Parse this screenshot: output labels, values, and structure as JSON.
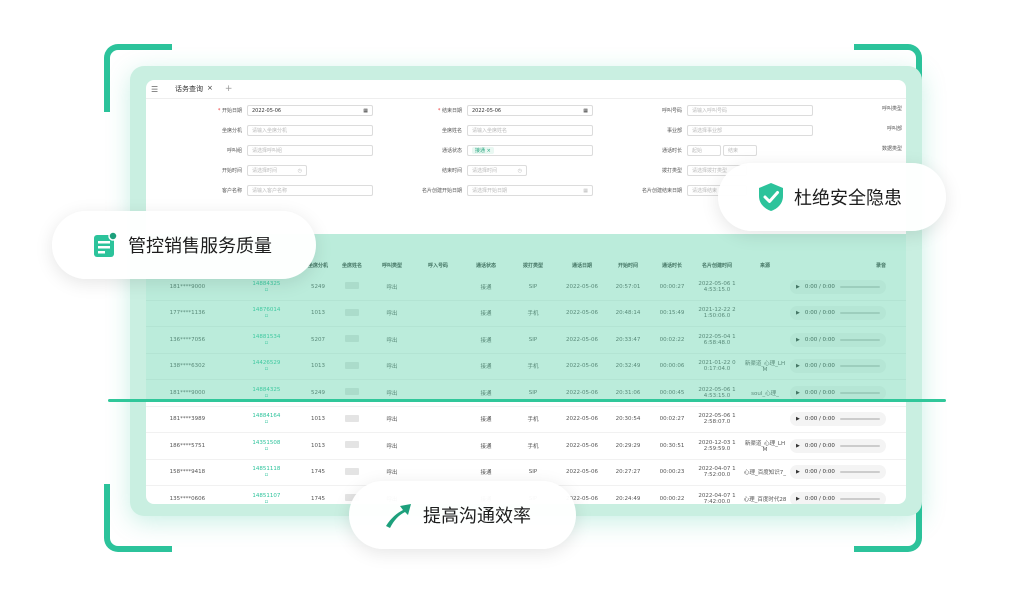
{
  "tab": {
    "label": "话务查询",
    "close": "×",
    "add": "+"
  },
  "form": {
    "start_date_label": "开始日期",
    "start_date_value": "2022-05-06",
    "end_date_label": "结束日期",
    "end_date_value": "2022-05-06",
    "caller_label": "呼叫号码",
    "caller_placeholder": "请输入呼叫号码",
    "call_type_label": "呼叫类型",
    "seat_ext_label": "坐席分机",
    "seat_ext_placeholder": "请输入坐席分机",
    "seat_name_label": "坐席姓名",
    "seat_name_placeholder": "请输入坐席姓名",
    "dept_label": "事业部",
    "dept_placeholder": "请选择事业部",
    "group_label": "呼叫部",
    "call_group_label": "呼叫组",
    "call_group_placeholder": "请选择呼叫组",
    "status_label": "通话状态",
    "status_chip": "接通",
    "duration_label": "通话时长",
    "duration_from": "起始",
    "duration_to": "结束",
    "data_type_label": "数据类型",
    "start_time_label": "开始时间",
    "start_time_placeholder": "请选择时间",
    "end_time_label": "结束时间",
    "end_time_placeholder": "请选择时间",
    "dial_type_label": "拨打类型",
    "dial_type_placeholder": "请选择拨打类型",
    "customer_label": "客户名称",
    "customer_placeholder": "请输入客户名称",
    "card_start_label": "名片创建开始日期",
    "card_start_placeholder": "请选择开始日期",
    "card_end_label": "名片创建结束日期",
    "card_end_placeholder": "请选择结束"
  },
  "table": {
    "headers": [
      "坐席分机",
      "坐席姓名",
      "呼叫类型",
      "呼入号码",
      "通话状态",
      "拨打类型",
      "通话日期",
      "开始时间",
      "通话时长",
      "名片创建时间",
      "来源",
      "录音"
    ],
    "rows": [
      {
        "phone": "181****9000",
        "id": "14884325",
        "ext": "5249",
        "type": "呼出",
        "status": "接通",
        "dial": "SIP",
        "date": "2022-05-06",
        "start": "20:57:01",
        "dur": "00:00:27",
        "created_a": "2022-05-06 1",
        "created_b": "4:53:15.0",
        "source": "",
        "extra": ""
      },
      {
        "phone": "177****1136",
        "id": "14876014",
        "ext": "1013",
        "type": "呼出",
        "status": "接通",
        "dial": "手机",
        "date": "2022-05-06",
        "start": "20:48:14",
        "dur": "00:15:49",
        "created_a": "2021-12-22 2",
        "created_b": "1:50:06.0",
        "source": "",
        "extra": ""
      },
      {
        "phone": "136****7056",
        "id": "14881534",
        "ext": "5207",
        "type": "呼出",
        "status": "接通",
        "dial": "SIP",
        "date": "2022-05-06",
        "start": "20:33:47",
        "dur": "00:02:22",
        "created_a": "2022-05-04 1",
        "created_b": "6:58:48.0",
        "source": "",
        "extra": "忙碌添加微信"
      },
      {
        "phone": "138****6302",
        "id": "14426529",
        "ext": "1013",
        "type": "呼出",
        "status": "接通",
        "dial": "手机",
        "date": "2022-05-06",
        "start": "20:32:49",
        "dur": "00:00:06",
        "created_a": "2021-01-22 0",
        "created_b": "0:17:04.0",
        "source": "新渠道_心理_LH",
        "source_b": "M",
        "extra": ""
      },
      {
        "phone": "181****9000",
        "id": "14884325",
        "ext": "5249",
        "type": "呼出",
        "status": "接通",
        "dial": "SIP",
        "date": "2022-05-06",
        "start": "20:31:06",
        "dur": "00:00:45",
        "created_a": "2022-05-06 1",
        "created_b": "4:53:15.0",
        "source": "soul_心理_",
        "extra": ""
      },
      {
        "phone": "181****3989",
        "id": "14884164",
        "ext": "1013",
        "type": "呼出",
        "status": "接通",
        "dial": "手机",
        "date": "2022-05-06",
        "start": "20:30:54",
        "dur": "00:02:27",
        "created_a": "2022-05-06 1",
        "created_b": "2:58:07.0",
        "source": "",
        "extra": ""
      },
      {
        "phone": "186****5751",
        "id": "14351508",
        "ext": "1013",
        "type": "呼出",
        "status": "接通",
        "dial": "手机",
        "date": "2022-05-06",
        "start": "20:29:29",
        "dur": "00:30:51",
        "created_a": "2020-12-03 1",
        "created_b": "2:59:59.0",
        "source": "新渠道_心理_LH",
        "source_b": "M",
        "extra": ""
      },
      {
        "phone": "158****9418",
        "id": "14851118",
        "ext": "1745",
        "type": "呼出",
        "status": "接通",
        "dial": "SIP",
        "date": "2022-05-06",
        "start": "20:27:27",
        "dur": "00:00:23",
        "created_a": "2022-04-07 1",
        "created_b": "7:52:00.0",
        "source": "心理_百度知识7_",
        "extra": ""
      },
      {
        "phone": "135****0606",
        "id": "14851107",
        "ext": "1745",
        "type": "呼出",
        "status": "接通",
        "dial": "SIP",
        "date": "2022-05-06",
        "start": "20:24:49",
        "dur": "00:00:22",
        "created_a": "2022-04-07 1",
        "created_b": "7:42:00.0",
        "source": "心理_百度时代28",
        "extra": ""
      }
    ],
    "audio_time": "0:00 / 0:00"
  },
  "badges": {
    "quality": "管控销售服务质量",
    "safety": "杜绝安全隐患",
    "efficiency": "提高沟通效率"
  },
  "colors": {
    "accent": "#2cc39b",
    "accent_dark": "#26a57f"
  }
}
